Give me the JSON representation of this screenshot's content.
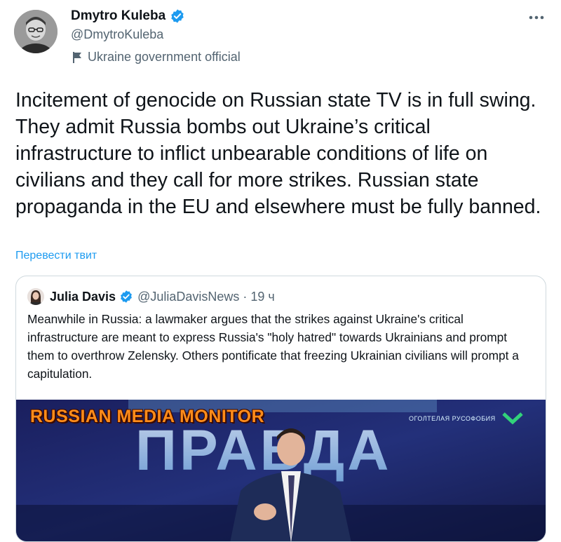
{
  "author": {
    "name": "Dmytro Kuleba",
    "handle": "@DmytroKuleba",
    "label": "Ukraine government official",
    "verified_color": "#1d9bf0"
  },
  "icons": {
    "verified": "verified-badge-icon",
    "more": "more-horizontal-icon",
    "label": "flag-icon"
  },
  "tweet": {
    "text": "Incitement of genocide on Russian state TV is in full swing. They admit Russia bombs out Ukraine’s critical infrastructure to inflict unbearable conditions of life on civilians and they call for more strikes. Russian state propaganda in the EU and elsewhere must be fully banned.",
    "translate_label": "Перевести твит"
  },
  "quote": {
    "name": "Julia Davis",
    "handle": "@JuliaDavisNews",
    "separator": "·",
    "time": "19 ч",
    "text": "Meanwhile in Russia: a lawmaker argues that the strikes against Ukraine's critical infrastructure are meant to express Russia's \"holy hatred\" towards Ukrainians and prompt them to overthrow Zelensky. Others pontificate that freezing Ukrainian civilians will prompt a capitulation.",
    "media": {
      "overlay_title": "RUSSIAN MEDIA MONITOR",
      "channel_tag": "ОГОЛТЕЛАЯ РУСОФОБИЯ",
      "screen_text": "ПРАВДА"
    }
  },
  "colors": {
    "text_primary": "#0f1419",
    "text_secondary": "#536471",
    "link": "#1d9bf0",
    "border": "#cfd9de"
  }
}
